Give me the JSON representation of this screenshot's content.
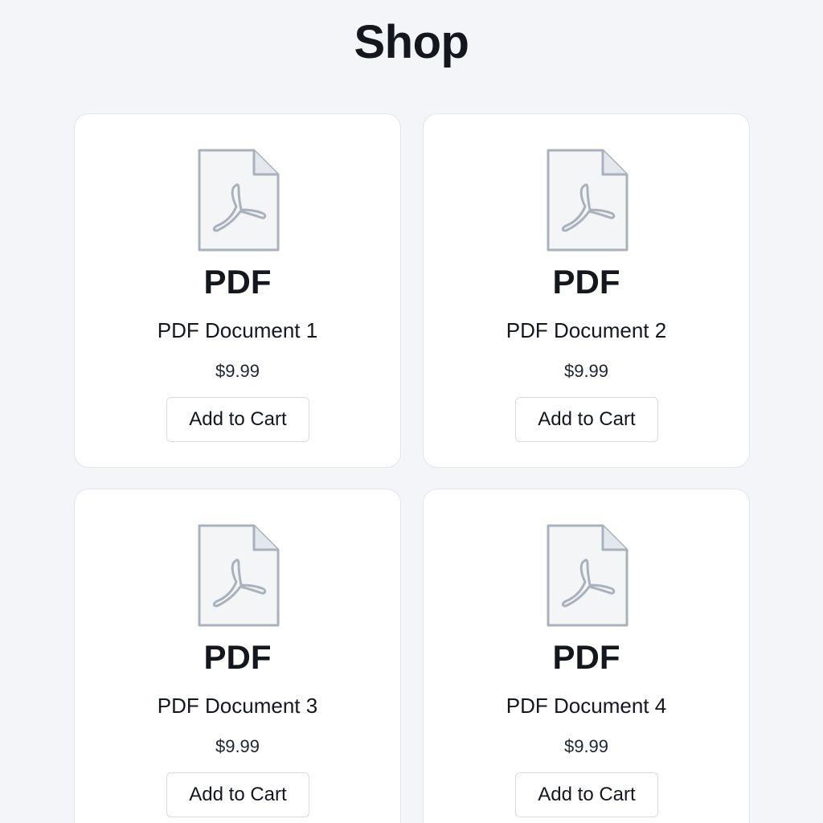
{
  "header": {
    "title": "Shop"
  },
  "products": [
    {
      "icon": "pdf-file-icon",
      "type_label": "PDF",
      "name": "PDF Document 1",
      "price": "$9.99",
      "button_label": "Add to Cart"
    },
    {
      "icon": "pdf-file-icon",
      "type_label": "PDF",
      "name": "PDF Document 2",
      "price": "$9.99",
      "button_label": "Add to Cart"
    },
    {
      "icon": "pdf-file-icon",
      "type_label": "PDF",
      "name": "PDF Document 3",
      "price": "$9.99",
      "button_label": "Add to Cart"
    },
    {
      "icon": "pdf-file-icon",
      "type_label": "PDF",
      "name": "PDF Document 4",
      "price": "$9.99",
      "button_label": "Add to Cart"
    }
  ],
  "colors": {
    "background": "#f3f5f8",
    "card": "#ffffff",
    "icon_stroke": "#a9b2bc",
    "icon_fill": "#f3f5f7"
  }
}
